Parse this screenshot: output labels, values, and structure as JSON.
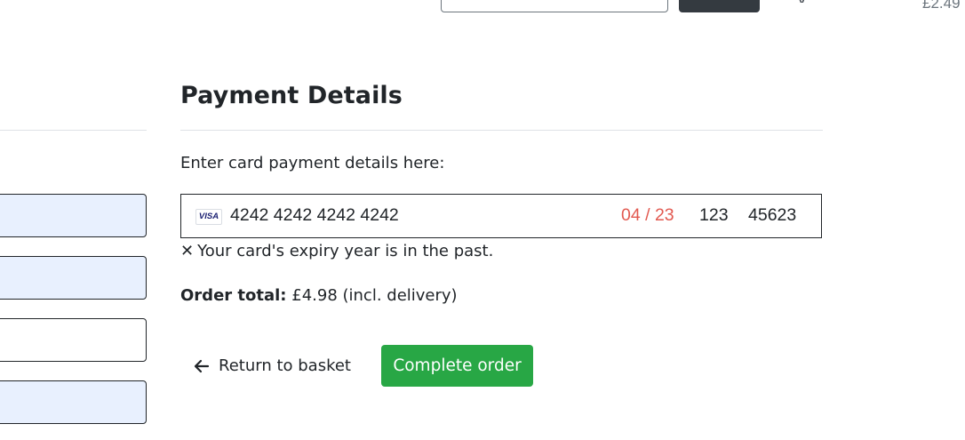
{
  "top_bar": {
    "price": "£2.49"
  },
  "payment": {
    "heading": "Payment Details",
    "intro": "Enter card payment details here:",
    "card": {
      "brand_icon": "visa-icon",
      "brand_text": "VISA",
      "number": "4242 4242 4242 4242",
      "expiry": "04 / 23",
      "cvc": "123",
      "postal_code": "45623",
      "expiry_error_color": "#e25950"
    },
    "error": {
      "icon": "close-icon",
      "icon_glyph": "✕",
      "message": "Your card's expiry year is in the past."
    },
    "order_total": {
      "label": "Order total:",
      "value": "£4.98 (incl. delivery)"
    },
    "actions": {
      "return_icon": "arrow-left-icon",
      "return_label": "Return to basket",
      "complete_label": "Complete order",
      "complete_color": "#28a745"
    }
  },
  "left_form": {
    "fields": [
      {
        "state": "autofilled"
      },
      {
        "state": "autofilled"
      },
      {
        "state": "empty"
      },
      {
        "state": "autofilled"
      }
    ]
  }
}
